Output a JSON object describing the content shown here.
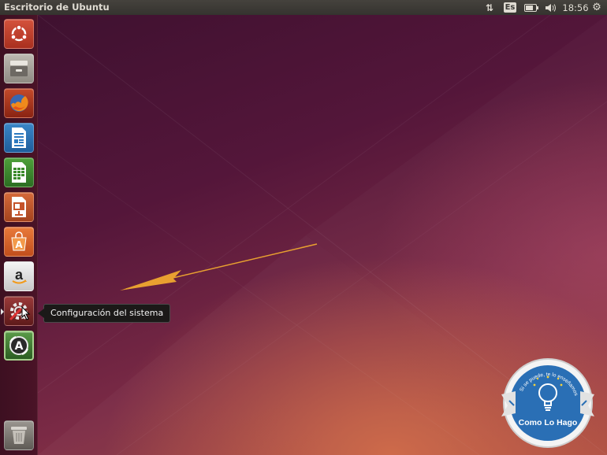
{
  "top_panel": {
    "title": "Escritorio de Ubuntu",
    "keyboard_layout": "Es",
    "clock": "18:56",
    "icons": [
      "network-icon",
      "keyboard-layout-indicator",
      "battery-icon",
      "volume-icon",
      "clock",
      "session-gear-icon"
    ]
  },
  "launcher": {
    "items": [
      {
        "name": "dash-home",
        "icon": "ubuntu-logo-icon",
        "color": "#c9402f"
      },
      {
        "name": "files",
        "icon": "file-cabinet-icon",
        "color": "#a7a39a"
      },
      {
        "name": "firefox",
        "icon": "firefox-icon",
        "color": "#b4331c"
      },
      {
        "name": "libreoffice-writer",
        "icon": "writer-document-icon",
        "color": "#2d7ac0"
      },
      {
        "name": "libreoffice-calc",
        "icon": "calc-spreadsheet-icon",
        "color": "#3a8a2a"
      },
      {
        "name": "libreoffice-impress",
        "icon": "impress-presentation-icon",
        "color": "#c5532a"
      },
      {
        "name": "ubuntu-software-center",
        "icon": "shopping-bag-icon",
        "color": "#d4622a"
      },
      {
        "name": "amazon",
        "icon": "amazon-icon",
        "color": "#b8b8b8"
      },
      {
        "name": "system-settings",
        "icon": "settings-gear-wrench-icon",
        "color": "#8e2a2a"
      },
      {
        "name": "software-updater",
        "icon": "software-updater-icon",
        "color": "#3f7a35"
      },
      {
        "name": "trash",
        "icon": "trash-icon",
        "color": "#7f7b76"
      }
    ]
  },
  "tooltip": {
    "label": "Configuración del sistema"
  },
  "watermark": {
    "arc_text": "Si se puede, te lo enseñamos",
    "name": "Como Lo Hago",
    "accent_color": "#2a6fb5"
  },
  "annotation": {
    "arrow_color": "#e8a030"
  }
}
